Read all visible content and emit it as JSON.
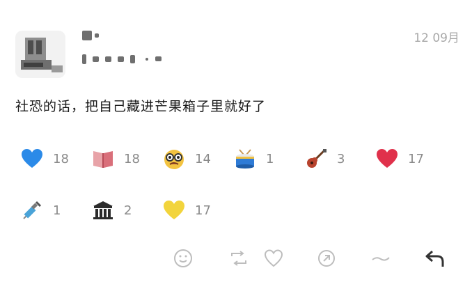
{
  "post": {
    "timestamp": "12 09月",
    "text": "社恐的话，把自己藏进芒果箱子里就好了"
  },
  "reactions": [
    {
      "icon": "blue-heart-icon",
      "count": "18"
    },
    {
      "icon": "book-icon",
      "count": "18"
    },
    {
      "icon": "face-with-glasses-icon",
      "count": "14"
    },
    {
      "icon": "drum-icon",
      "count": "1"
    },
    {
      "icon": "guitar-icon",
      "count": "3"
    },
    {
      "icon": "red-heart-icon",
      "count": "17"
    },
    {
      "icon": "syringe-icon",
      "count": "1"
    },
    {
      "icon": "classical-building-icon",
      "count": "2"
    },
    {
      "icon": "yellow-heart-icon",
      "count": "17"
    }
  ],
  "colors": {
    "text": "#1b1b1b",
    "muted": "#8a8a8a",
    "timestamp": "#a8a8a8",
    "action_icon": "#bdbdbd",
    "reply_icon": "#333333"
  },
  "actions": [
    "smile-icon",
    "repost-icon",
    "like-icon",
    "share-icon",
    "more-icon",
    "reply-icon"
  ]
}
